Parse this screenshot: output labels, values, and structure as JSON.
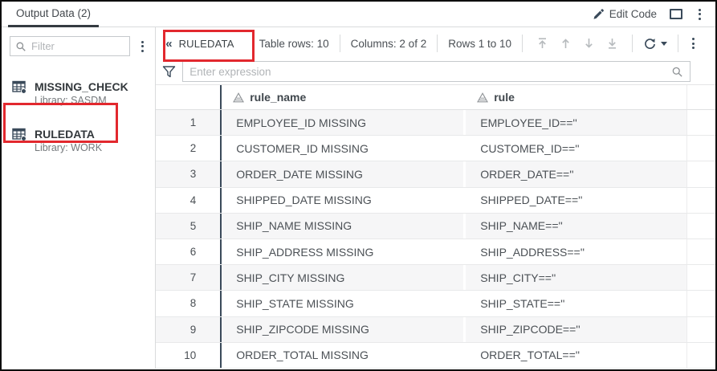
{
  "window": {
    "tab_label": "Output Data (2)",
    "edit_code_label": "Edit Code"
  },
  "sidebar": {
    "filter_placeholder": "Filter",
    "items": [
      {
        "name": "MISSING_CHECK",
        "library": "Library: SASDM",
        "highlighted": false
      },
      {
        "name": "RULEDATA",
        "library": "Library: WORK",
        "highlighted": true
      }
    ]
  },
  "toolbar": {
    "collapse_icon": "chevron-double-left",
    "table_name": "RULEDATA",
    "table_rows_label": "Table rows: 10",
    "columns_label": "Columns: 2 of 2",
    "rows_label": "Rows 1 to 10"
  },
  "filter_bar": {
    "placeholder": "Enter expression"
  },
  "table": {
    "columns": [
      {
        "name": "rule_name",
        "type": "character"
      },
      {
        "name": "rule",
        "type": "character"
      }
    ],
    "rows": [
      {
        "n": "1",
        "rule_name": "EMPLOYEE_ID MISSING",
        "rule": "EMPLOYEE_ID==''"
      },
      {
        "n": "2",
        "rule_name": "CUSTOMER_ID MISSING",
        "rule": "CUSTOMER_ID==''"
      },
      {
        "n": "3",
        "rule_name": "ORDER_DATE MISSING",
        "rule": "ORDER_DATE==''"
      },
      {
        "n": "4",
        "rule_name": "SHIPPED_DATE MISSING",
        "rule": "SHIPPED_DATE==''"
      },
      {
        "n": "5",
        "rule_name": "SHIP_NAME MISSING",
        "rule": "SHIP_NAME==''"
      },
      {
        "n": "6",
        "rule_name": "SHIP_ADDRESS MISSING",
        "rule": "SHIP_ADDRESS==''"
      },
      {
        "n": "7",
        "rule_name": "SHIP_CITY MISSING",
        "rule": "SHIP_CITY==''"
      },
      {
        "n": "8",
        "rule_name": "SHIP_STATE MISSING",
        "rule": "SHIP_STATE==''"
      },
      {
        "n": "9",
        "rule_name": "SHIP_ZIPCODE MISSING",
        "rule": "SHIP_ZIPCODE==''"
      },
      {
        "n": "10",
        "rule_name": "ORDER_TOTAL MISSING",
        "rule": "ORDER_TOTAL==''"
      }
    ]
  },
  "colors": {
    "annotation_red": "#e2282e",
    "accent_navy": "#3a4a5a",
    "stripe": "#f6f6f7"
  }
}
